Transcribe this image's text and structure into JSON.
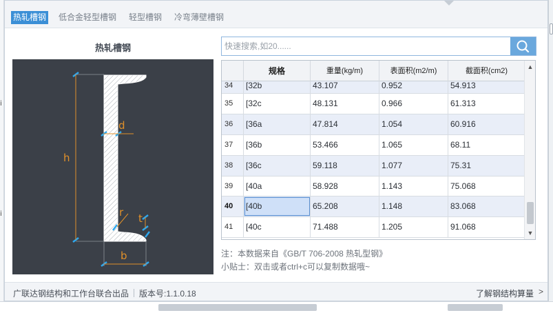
{
  "tabs": [
    {
      "label": "热轧槽钢",
      "active": true
    },
    {
      "label": "低合金轻型槽钢",
      "active": false
    },
    {
      "label": "轻型槽钢",
      "active": false
    },
    {
      "label": "冷弯薄壁槽钢",
      "active": false
    }
  ],
  "left_title": "热轧槽钢",
  "diagram": {
    "label_d": "d",
    "label_h": "h",
    "label_r": "r",
    "label_t": "t",
    "label_b": "b"
  },
  "search": {
    "placeholder": "快速搜索,如20......",
    "icon": "search-icon"
  },
  "table": {
    "headers": [
      "",
      "规格",
      "重量(kg/m)",
      "表面积(m2/m)",
      "截面积(cm2)"
    ],
    "rows": [
      {
        "index": "34",
        "spec": "[32b",
        "weight": "43.107",
        "surface": "0.952",
        "section": "54.913"
      },
      {
        "index": "35",
        "spec": "[32c",
        "weight": "48.131",
        "surface": "0.966",
        "section": "61.313"
      },
      {
        "index": "36",
        "spec": "[36a",
        "weight": "47.814",
        "surface": "1.054",
        "section": "60.916"
      },
      {
        "index": "37",
        "spec": "[36b",
        "weight": "53.466",
        "surface": "1.065",
        "section": "68.11"
      },
      {
        "index": "38",
        "spec": "[36c",
        "weight": "59.118",
        "surface": "1.077",
        "section": "75.31"
      },
      {
        "index": "39",
        "spec": "[40a",
        "weight": "58.928",
        "surface": "1.143",
        "section": "75.068"
      },
      {
        "index": "40",
        "spec": "[40b",
        "weight": "65.208",
        "surface": "1.148",
        "section": "83.068",
        "selected": true
      },
      {
        "index": "41",
        "spec": "[40c",
        "weight": "71.488",
        "surface": "1.205",
        "section": "91.068"
      }
    ]
  },
  "notes": {
    "source": "注：本数据来自《GB/T  706-2008 热轧型钢》",
    "tip": "小贴士：双击或者ctrl+c可以复制数据哦~"
  },
  "footer": {
    "publisher": "广联达钢结构和工作台联合出品",
    "version": "版本号:1.1.0.18",
    "link": "了解钢结构算量"
  },
  "colors": {
    "accent": "#3b8fd6",
    "diagram_bg": "#3b4048",
    "dimension": "#e0902a",
    "marker": "#2ea8ee",
    "row_alt": "#e9eef8"
  }
}
